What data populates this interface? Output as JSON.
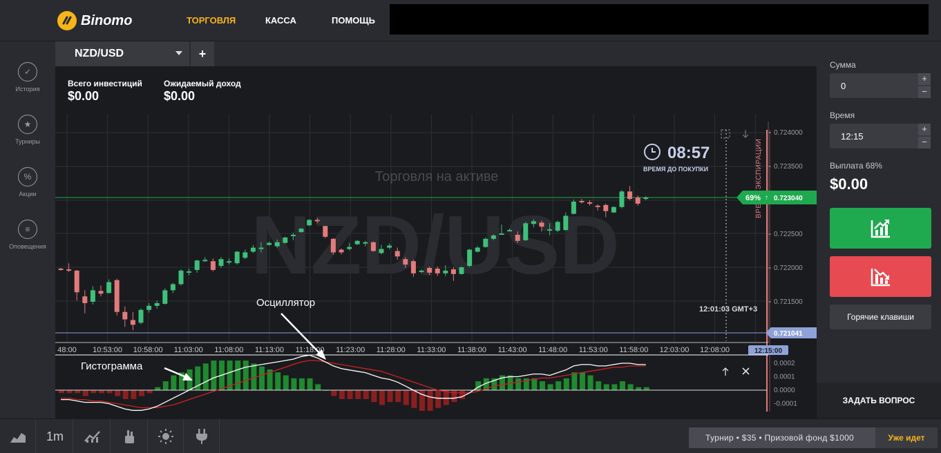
{
  "app": {
    "brand": "Binomo"
  },
  "nav": {
    "trade": "ТОРГОВЛЯ",
    "cashier": "КАССА",
    "help": "ПОМОЩЬ"
  },
  "sidebar": {
    "items": [
      {
        "label": "История",
        "icon": "check-circle-icon"
      },
      {
        "label": "Турниры",
        "icon": "trophy-icon"
      },
      {
        "label": "Акции",
        "icon": "percent-icon"
      },
      {
        "label": "Оповещения",
        "icon": "menu-lines-icon"
      }
    ]
  },
  "tabs": {
    "asset": "NZD/USD",
    "add": "+"
  },
  "investments": {
    "total_label": "Всего инвестиций",
    "total_value": "$0.00",
    "expected_label": "Ожидаемый доход",
    "expected_value": "$0.00"
  },
  "chart": {
    "watermark": "NZD/USD",
    "trading_hint": "Торговля на активе",
    "timer_value": "08:57",
    "timer_label": "ВРЕМЯ ДО ПОКУПКИ",
    "expiry_label": "ВРЕМЯ ЭКСПИРАЦИИ",
    "gmt_time": "12:01:03 GMT+3",
    "current_price": "0.723040",
    "payout_badge": "69%",
    "low_price": "0.721041",
    "expiry_time_tag": "12:15:00",
    "y_ticks": [
      "0.724000",
      "0.723500",
      "0.723000",
      "0.722500",
      "0.722000",
      "0.721500"
    ],
    "x_ticks": [
      "48:00",
      "10:53:00",
      "10:58:00",
      "11:03:00",
      "11:08:00",
      "11:13:00",
      "11:18:00",
      "11:23:00",
      "11:28:00",
      "11:33:00",
      "11:38:00",
      "11:43:00",
      "11:48:00",
      "11:53:00",
      "11:58:00",
      "12:03:00",
      "12:08:00",
      "12:"
    ],
    "osc_ticks": [
      "0.0002",
      "0.0001",
      "0.0000",
      "-0.0001"
    ],
    "annotation_oscillator": "Осциллятор",
    "annotation_histogram": "Гистограмма",
    "colors": {
      "up": "#3ec07a",
      "down": "#e37b7b",
      "macd": "#ffffff",
      "signal": "#cc2222",
      "hist_up": "#1f8a2f",
      "hist_down": "#8a1f1f"
    }
  },
  "chart_data": {
    "type": "candlestick",
    "instrument": "NZD/USD",
    "ylim": [
      0.72104,
      0.724
    ],
    "candles": [
      {
        "o": 0.72199,
        "c": 0.72198,
        "h": 0.722,
        "l": 0.72196
      },
      {
        "o": 0.72198,
        "c": 0.72197,
        "h": 0.72207,
        "l": 0.72194
      },
      {
        "o": 0.72196,
        "c": 0.72164,
        "h": 0.72197,
        "l": 0.72152
      },
      {
        "o": 0.72158,
        "c": 0.72148,
        "h": 0.72167,
        "l": 0.72133
      },
      {
        "o": 0.7215,
        "c": 0.72167,
        "h": 0.72173,
        "l": 0.72146
      },
      {
        "o": 0.72166,
        "c": 0.72162,
        "h": 0.72174,
        "l": 0.72158
      },
      {
        "o": 0.72163,
        "c": 0.72179,
        "h": 0.72183,
        "l": 0.72162
      },
      {
        "o": 0.72182,
        "c": 0.72135,
        "h": 0.72184,
        "l": 0.7213
      },
      {
        "o": 0.72135,
        "c": 0.72124,
        "h": 0.72143,
        "l": 0.72113
      },
      {
        "o": 0.72123,
        "c": 0.72116,
        "h": 0.72135,
        "l": 0.72108
      },
      {
        "o": 0.72119,
        "c": 0.72138,
        "h": 0.7214,
        "l": 0.72117
      },
      {
        "o": 0.72138,
        "c": 0.72144,
        "h": 0.72148,
        "l": 0.72134
      },
      {
        "o": 0.72144,
        "c": 0.72148,
        "h": 0.72152,
        "l": 0.7214
      },
      {
        "o": 0.72147,
        "c": 0.72167,
        "h": 0.7217,
        "l": 0.72146
      },
      {
        "o": 0.72167,
        "c": 0.72176,
        "h": 0.72178,
        "l": 0.72163
      },
      {
        "o": 0.72176,
        "c": 0.72196,
        "h": 0.72198,
        "l": 0.72174
      },
      {
        "o": 0.72193,
        "c": 0.72195,
        "h": 0.72199,
        "l": 0.72189
      },
      {
        "o": 0.72197,
        "c": 0.72211,
        "h": 0.72212,
        "l": 0.72193
      },
      {
        "o": 0.7221,
        "c": 0.72212,
        "h": 0.72216,
        "l": 0.72209
      },
      {
        "o": 0.7221,
        "c": 0.72197,
        "h": 0.72214,
        "l": 0.72195
      },
      {
        "o": 0.72203,
        "c": 0.72213,
        "h": 0.72216,
        "l": 0.722
      },
      {
        "o": 0.72209,
        "c": 0.7221,
        "h": 0.72214,
        "l": 0.72205
      },
      {
        "o": 0.72207,
        "c": 0.72224,
        "h": 0.72225,
        "l": 0.72205
      },
      {
        "o": 0.72215,
        "c": 0.72223,
        "h": 0.72227,
        "l": 0.72213
      },
      {
        "o": 0.72224,
        "c": 0.7223,
        "h": 0.72234,
        "l": 0.72222
      },
      {
        "o": 0.72229,
        "c": 0.7223,
        "h": 0.72238,
        "l": 0.72223
      },
      {
        "o": 0.72234,
        "c": 0.72237,
        "h": 0.72239,
        "l": 0.72233
      },
      {
        "o": 0.72232,
        "c": 0.72238,
        "h": 0.72242,
        "l": 0.7223
      },
      {
        "o": 0.72237,
        "c": 0.72245,
        "h": 0.72246,
        "l": 0.72236
      },
      {
        "o": 0.72247,
        "c": 0.72249,
        "h": 0.72252,
        "l": 0.72241
      },
      {
        "o": 0.72253,
        "c": 0.72258,
        "h": 0.72259,
        "l": 0.72252
      },
      {
        "o": 0.72263,
        "c": 0.72271,
        "h": 0.72272,
        "l": 0.72262
      },
      {
        "o": 0.72271,
        "c": 0.72269,
        "h": 0.72274,
        "l": 0.72266
      },
      {
        "o": 0.72262,
        "c": 0.72246,
        "h": 0.72262,
        "l": 0.72244
      },
      {
        "o": 0.72243,
        "c": 0.72223,
        "h": 0.72244,
        "l": 0.7222
      },
      {
        "o": 0.72227,
        "c": 0.72223,
        "h": 0.72229,
        "l": 0.7222
      },
      {
        "o": 0.72228,
        "c": 0.72231,
        "h": 0.72237,
        "l": 0.72226
      },
      {
        "o": 0.72235,
        "c": 0.7224,
        "h": 0.72241,
        "l": 0.72234
      },
      {
        "o": 0.72238,
        "c": 0.72238,
        "h": 0.7224,
        "l": 0.72232
      },
      {
        "o": 0.72238,
        "c": 0.72225,
        "h": 0.72239,
        "l": 0.72224
      },
      {
        "o": 0.72222,
        "c": 0.72228,
        "h": 0.72234,
        "l": 0.7222
      },
      {
        "o": 0.7223,
        "c": 0.72233,
        "h": 0.72236,
        "l": 0.72228
      },
      {
        "o": 0.72225,
        "c": 0.72217,
        "h": 0.7223,
        "l": 0.72212
      },
      {
        "o": 0.72213,
        "c": 0.72205,
        "h": 0.72216,
        "l": 0.722
      },
      {
        "o": 0.7221,
        "c": 0.72192,
        "h": 0.72212,
        "l": 0.72187
      },
      {
        "o": 0.72195,
        "c": 0.72196,
        "h": 0.72198,
        "l": 0.72192
      },
      {
        "o": 0.722,
        "c": 0.72193,
        "h": 0.72202,
        "l": 0.72189
      },
      {
        "o": 0.72199,
        "c": 0.72192,
        "h": 0.72202,
        "l": 0.72188
      },
      {
        "o": 0.72192,
        "c": 0.72196,
        "h": 0.72204,
        "l": 0.72188
      },
      {
        "o": 0.72198,
        "c": 0.72191,
        "h": 0.72201,
        "l": 0.72181
      },
      {
        "o": 0.72191,
        "c": 0.72201,
        "h": 0.72202,
        "l": 0.7219
      },
      {
        "o": 0.72203,
        "c": 0.72227,
        "h": 0.72228,
        "l": 0.72201
      },
      {
        "o": 0.72224,
        "c": 0.7223,
        "h": 0.72232,
        "l": 0.72223
      },
      {
        "o": 0.72231,
        "c": 0.72243,
        "h": 0.72245,
        "l": 0.7223
      },
      {
        "o": 0.72243,
        "c": 0.72248,
        "h": 0.7225,
        "l": 0.72241
      },
      {
        "o": 0.72251,
        "c": 0.72251,
        "h": 0.72264,
        "l": 0.72249
      },
      {
        "o": 0.72256,
        "c": 0.72256,
        "h": 0.72258,
        "l": 0.72254
      },
      {
        "o": 0.72249,
        "c": 0.7224,
        "h": 0.72254,
        "l": 0.72237
      },
      {
        "o": 0.72241,
        "c": 0.72266,
        "h": 0.72268,
        "l": 0.7224
      },
      {
        "o": 0.72265,
        "c": 0.72269,
        "h": 0.72272,
        "l": 0.7226
      },
      {
        "o": 0.72267,
        "c": 0.72261,
        "h": 0.7227,
        "l": 0.72254
      },
      {
        "o": 0.72257,
        "c": 0.72257,
        "h": 0.72266,
        "l": 0.72248
      },
      {
        "o": 0.72255,
        "c": 0.72268,
        "h": 0.7227,
        "l": 0.72253
      },
      {
        "o": 0.72256,
        "c": 0.72277,
        "h": 0.72282,
        "l": 0.72255
      },
      {
        "o": 0.7228,
        "c": 0.72298,
        "h": 0.72301,
        "l": 0.72279
      },
      {
        "o": 0.72299,
        "c": 0.72298,
        "h": 0.72302,
        "l": 0.72295
      },
      {
        "o": 0.72297,
        "c": 0.72295,
        "h": 0.723,
        "l": 0.72292
      },
      {
        "o": 0.72292,
        "c": 0.7229,
        "h": 0.72294,
        "l": 0.72285
      },
      {
        "o": 0.72293,
        "c": 0.72284,
        "h": 0.72295,
        "l": 0.72275
      },
      {
        "o": 0.72282,
        "c": 0.7229,
        "h": 0.72291,
        "l": 0.72281
      },
      {
        "o": 0.7229,
        "c": 0.72313,
        "h": 0.72315,
        "l": 0.72288
      },
      {
        "o": 0.72313,
        "c": 0.72302,
        "h": 0.72321,
        "l": 0.723
      },
      {
        "o": 0.72304,
        "c": 0.72295,
        "h": 0.72307,
        "l": 0.72292
      },
      {
        "o": 0.72302,
        "c": 0.72304,
        "h": 0.72306,
        "l": 0.723
      }
    ],
    "oscillator": {
      "macd": [
        -7e-05,
        -7e-05,
        -8e-05,
        -9e-05,
        -9e-05,
        -9e-05,
        -0.0001,
        -0.00012,
        -0.00014,
        -0.00015,
        -0.00015,
        -0.00014,
        -0.00012,
        -9e-05,
        -6e-05,
        -3e-05,
        0.0,
        3e-05,
        6e-05,
        9e-05,
        0.00011,
        0.00013,
        0.00015,
        0.00017,
        0.00018,
        0.00019,
        0.0002,
        0.00021,
        0.00022,
        0.00023,
        0.00025,
        0.00026,
        0.00024,
        0.00021,
        0.00018,
        0.00016,
        0.00015,
        0.00014,
        0.00013,
        0.00011,
        9e-05,
        8e-05,
        6e-05,
        3e-05,
        0.0,
        -3e-05,
        -5e-05,
        -6e-05,
        -6e-05,
        -6e-05,
        -5e-05,
        -2e-05,
        2e-05,
        5e-05,
        7e-05,
        9e-05,
        0.0001,
        0.0001,
        0.00011,
        0.00012,
        0.00012,
        0.00011,
        0.00013,
        0.00015,
        0.00018,
        0.00019,
        0.00019,
        0.00018,
        0.00018,
        0.00019,
        0.0002,
        0.0002,
        0.00019,
        0.00019
      ],
      "signal": [
        -6e-05,
        -6e-05,
        -7e-05,
        -7e-05,
        -8e-05,
        -8e-05,
        -9e-05,
        -0.0001,
        -0.00011,
        -0.00012,
        -0.00013,
        -0.00013,
        -0.00013,
        -0.00012,
        -0.00011,
        -9e-05,
        -7e-05,
        -5e-05,
        -3e-05,
        -1e-05,
        1e-05,
        3e-05,
        5e-05,
        7e-05,
        9e-05,
        0.00011,
        0.00013,
        0.00015,
        0.00017,
        0.00019,
        0.00021,
        0.00022,
        0.00022,
        0.00021,
        0.0002,
        0.00019,
        0.00018,
        0.00017,
        0.00016,
        0.00015,
        0.00014,
        0.00012,
        0.0001,
        8e-05,
        6e-05,
        4e-05,
        2e-05,
        0.0,
        -1e-05,
        -2e-05,
        -2e-05,
        -2e-05,
        -1e-05,
        1e-05,
        3e-05,
        4e-05,
        5e-05,
        6e-05,
        7e-05,
        8e-05,
        9e-05,
        9e-05,
        0.0001,
        0.00011,
        0.00012,
        0.00013,
        0.00014,
        0.00015,
        0.00016,
        0.00017,
        0.00017,
        0.00018,
        0.00018,
        0.00018
      ]
    }
  },
  "right_panel": {
    "amount_label": "Сумма",
    "amount_value": "0",
    "time_label": "Время",
    "time_value": "12:15",
    "payout_label": "Выплата 68%",
    "payout_value": "$0.00",
    "hotkeys": "Горячие клавиши",
    "ask": "ЗАДАТЬ ВОПРОС",
    "plus": "+",
    "minus": "−"
  },
  "bottom": {
    "timeframe": "1m",
    "tournament": "Турнир • $35 • Призовой фонд $1000",
    "tournament_status": "Уже идет"
  }
}
